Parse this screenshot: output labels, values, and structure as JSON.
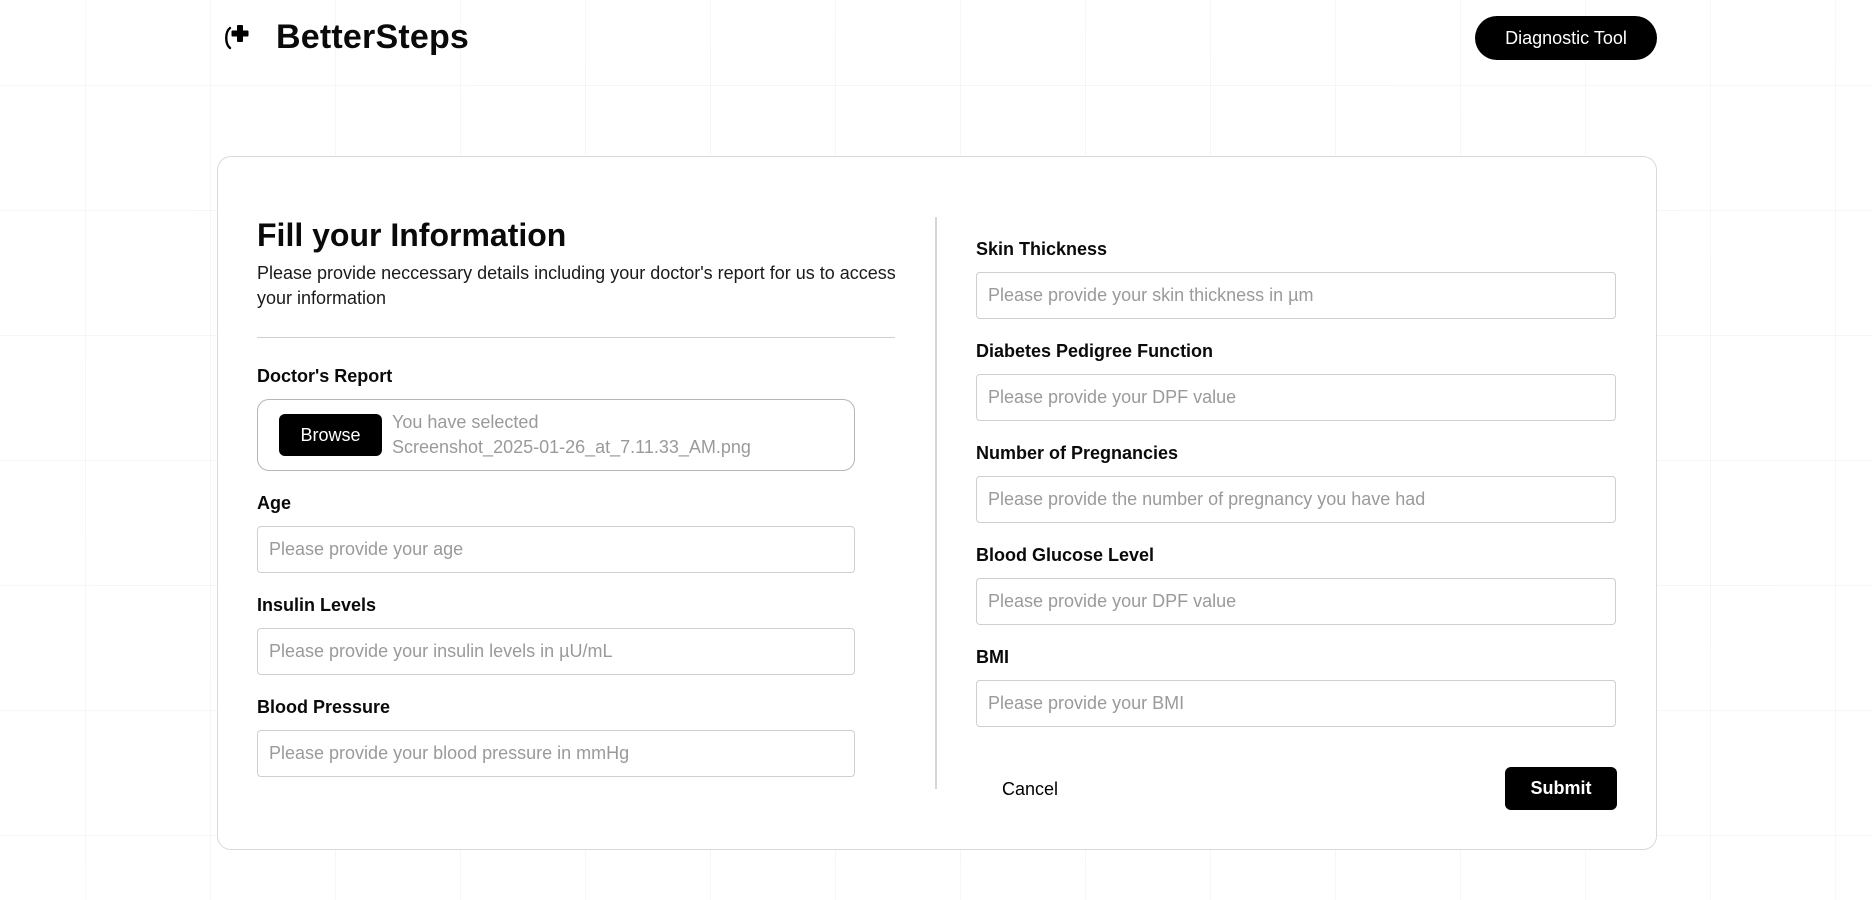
{
  "brand": {
    "name": "BetterSteps",
    "icon": "medical-cross-icon"
  },
  "header": {
    "diagnostic_button_label": "Diagnostic Tool"
  },
  "form": {
    "title": "Fill your Information",
    "subtitle": "Please provide neccessary details including your doctor's report for us to access your information",
    "doctors_report": {
      "label": "Doctor's Report",
      "browse_label": "Browse",
      "selected_prefix": "You have selected",
      "selected_file": "Screenshot_2025-01-26_at_7.11.33_AM.png"
    },
    "left_fields": [
      {
        "label": "Age",
        "placeholder": "Please provide your age",
        "value": ""
      },
      {
        "label": "Insulin Levels",
        "placeholder": "Please provide your insulin levels in µU/mL",
        "value": ""
      },
      {
        "label": "Blood Pressure",
        "placeholder": "Please provide your blood pressure in mmHg",
        "value": ""
      }
    ],
    "right_fields": [
      {
        "label": "Skin Thickness",
        "placeholder": "Please provide your skin thickness in µm",
        "value": ""
      },
      {
        "label": "Diabetes Pedigree Function",
        "placeholder": "Please provide your DPF value",
        "value": ""
      },
      {
        "label": "Number of Pregnancies",
        "placeholder": "Please provide the number of pregnancy you have had",
        "value": ""
      },
      {
        "label": "Blood Glucose Level",
        "placeholder": "Please provide your DPF value",
        "value": ""
      },
      {
        "label": "BMI",
        "placeholder": "Please provide your BMI",
        "value": ""
      }
    ],
    "cancel_label": "Cancel",
    "submit_label": "Submit"
  },
  "colors": {
    "primary": "#000000",
    "background": "#ffffff",
    "border": "#cfcfcf",
    "placeholder": "#9a9a9a"
  }
}
